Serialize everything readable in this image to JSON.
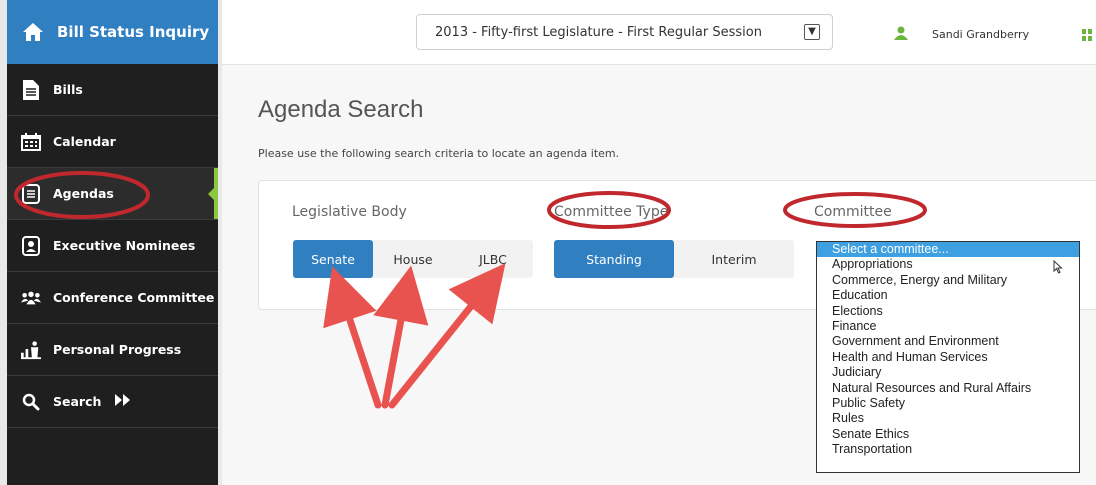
{
  "app": {
    "title": "Bill Status Inquiry"
  },
  "sidebar": {
    "items": [
      {
        "label": "Bills",
        "icon": "document-icon"
      },
      {
        "label": "Calendar",
        "icon": "calendar-icon"
      },
      {
        "label": "Agendas",
        "icon": "agenda-icon",
        "active": true
      },
      {
        "label": "Executive Nominees",
        "icon": "nominee-icon"
      },
      {
        "label": "Conference Committee",
        "icon": "people-icon"
      },
      {
        "label": "Personal Progress",
        "icon": "chart-person-icon"
      },
      {
        "label": "Search",
        "icon": "search-icon"
      }
    ]
  },
  "header": {
    "session": "2013 - Fifty-first Legislature - First Regular Session",
    "user": "Sandi Grandberry"
  },
  "main": {
    "title": "Agenda Search",
    "hint": "Please use the following search criteria to locate an agenda item.",
    "legislative_body": {
      "label": "Legislative Body",
      "options": [
        "Senate",
        "House",
        "JLBC"
      ],
      "selected": "Senate"
    },
    "committee_type": {
      "label": "Committee Type",
      "options": [
        "Standing",
        "Interim"
      ],
      "selected": "Standing"
    },
    "committee": {
      "label": "Committee",
      "options": [
        "Select a committee...",
        "Appropriations",
        "Commerce, Energy and Military",
        "Education",
        "Elections",
        "Finance",
        "Government and Environment",
        "Health and Human Services",
        "Judiciary",
        "Natural Resources and Rural Affairs",
        "Public Safety",
        "Rules",
        "Senate Ethics",
        "Transportation"
      ]
    }
  },
  "colors": {
    "brand_blue": "#2f7fc1",
    "sidebar_bg": "#1f1f1f",
    "active_green": "#8dc63f",
    "annotation_red": "#c0282d",
    "arrow_red": "#e8534f"
  }
}
